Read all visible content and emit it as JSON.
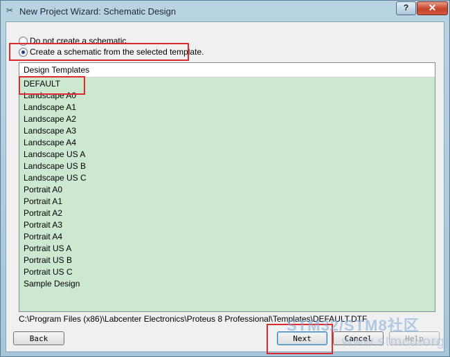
{
  "window": {
    "title": "New Project Wizard: Schematic Design",
    "help_label": "?",
    "close_label": "✕"
  },
  "options": {
    "no_schematic": "Do not create a schematic.",
    "from_template": "Create a schematic from the selected template."
  },
  "templates": {
    "header": "Design Templates",
    "items": [
      "DEFAULT",
      "Landscape A0",
      "Landscape A1",
      "Landscape A2",
      "Landscape A3",
      "Landscape A4",
      "Landscape US A",
      "Landscape US B",
      "Landscape US C",
      "Portrait A0",
      "Portrait A1",
      "Portrait A2",
      "Portrait A3",
      "Portrait A4",
      "Portrait US A",
      "Portrait US B",
      "Portrait US C",
      "Sample Design"
    ],
    "selected": "DEFAULT"
  },
  "path": "C:\\Program Files (x86)\\Labcenter Electronics\\Proteus 8 Professional\\Templates\\DEFAULT.DTF",
  "buttons": {
    "back": "Back",
    "next": "Next",
    "cancel": "Cancel",
    "help": "Help"
  },
  "watermark": {
    "line1": "STM32/STM8社区",
    "line2": "www.stmcu.org"
  }
}
